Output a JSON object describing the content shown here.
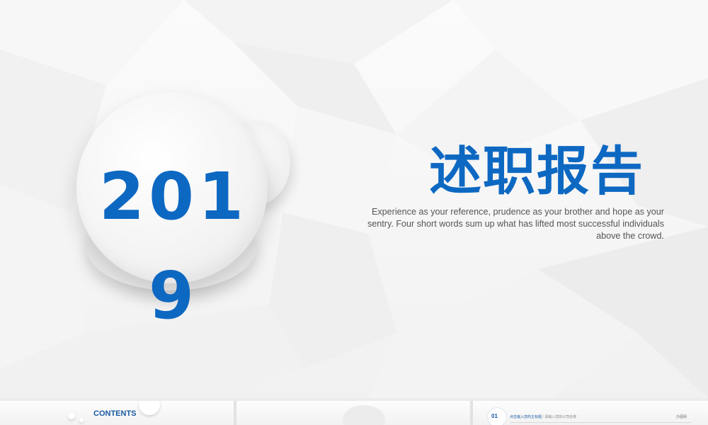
{
  "slide": {
    "year": "2019",
    "title": "述职报告",
    "subtitle": "Experience as your reference, prudence as your brother and hope as your sentry. Four short words sum up what has lifted most successful individuals above the crowd."
  },
  "thumbnails": [
    {
      "label": "CONTENTS"
    },
    {
      "label": ""
    },
    {
      "number": "01",
      "breadcrumb_main": "点击输入您的主标题",
      "separator": "/",
      "breadcrumb_sub": "请输入您的公司名称",
      "right_text": "办图网"
    }
  ],
  "colors": {
    "accent": "#0d68c2",
    "body_text": "#555555",
    "background": "#f5f5f5"
  }
}
